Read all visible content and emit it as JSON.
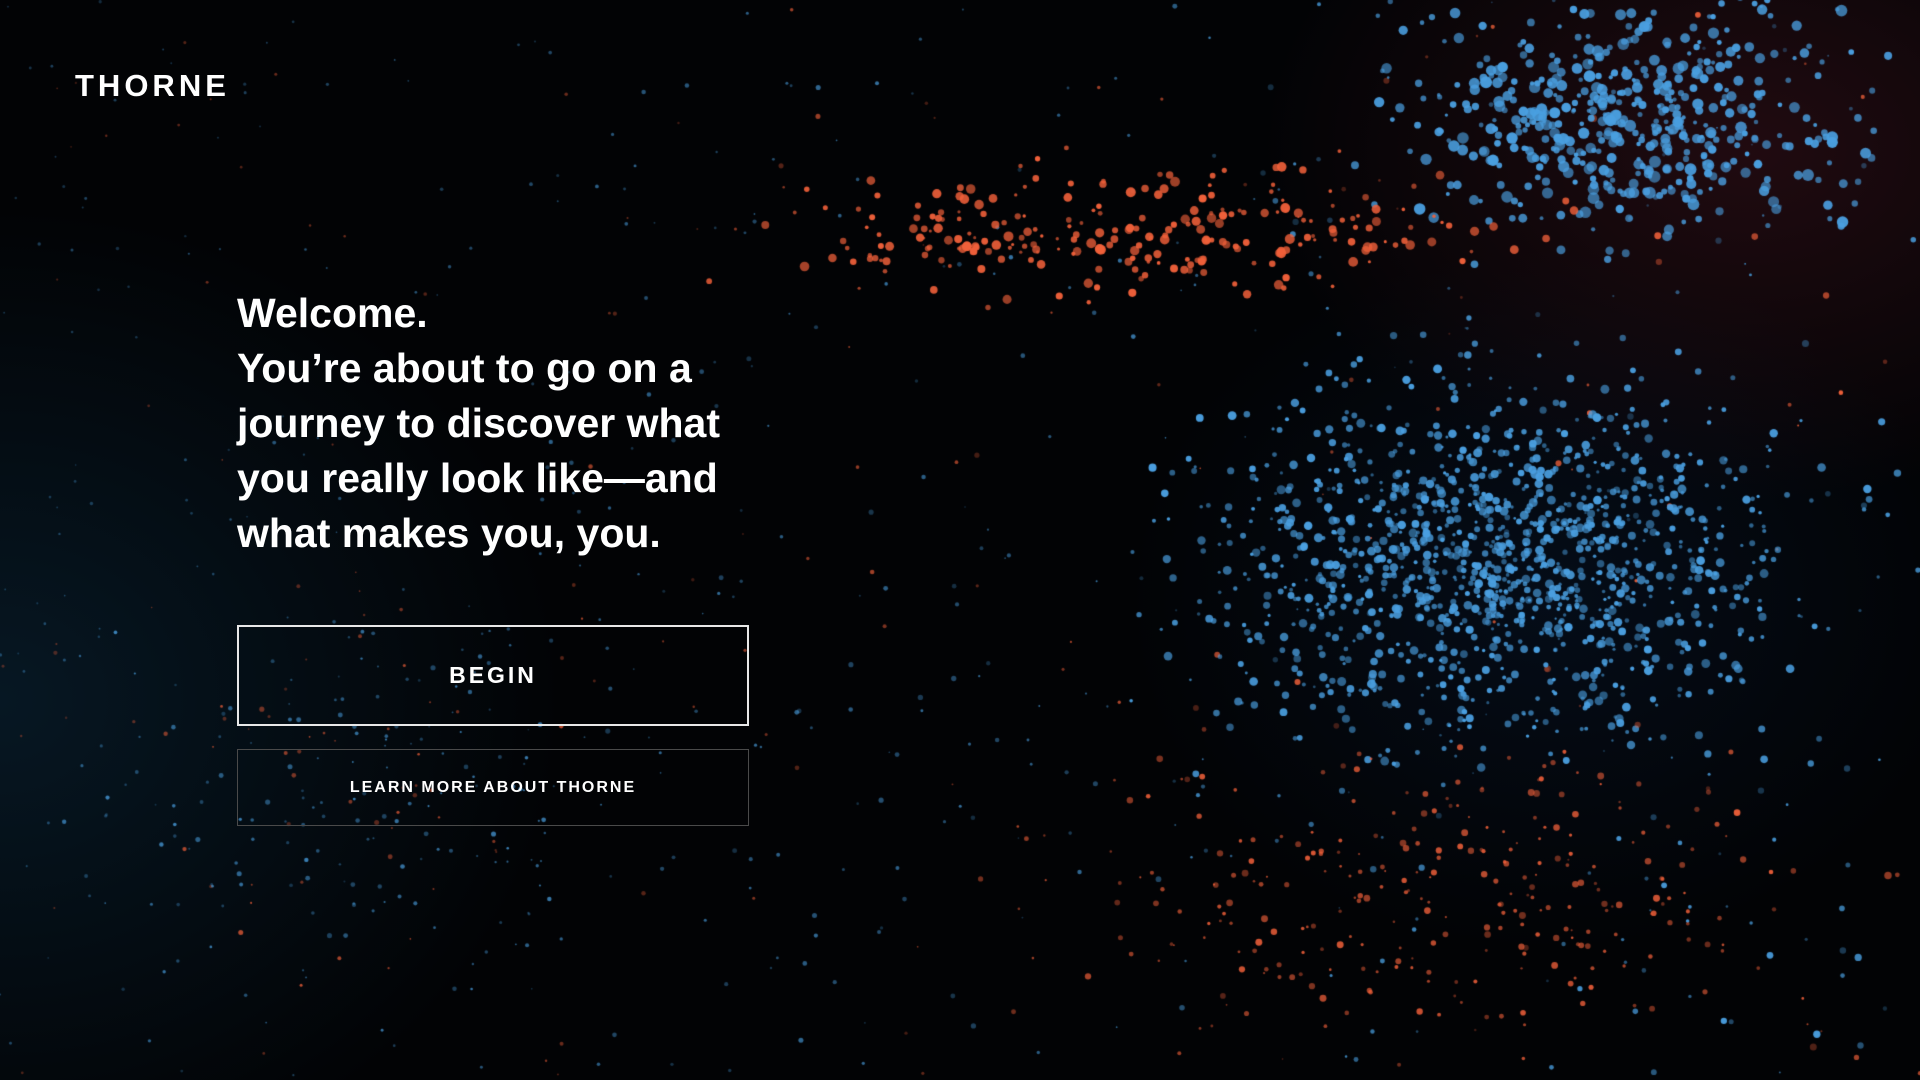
{
  "brand": {
    "logo_text": "THORNE"
  },
  "hero": {
    "headline": "Welcome.",
    "subhead": "You’re about to go on a journey to discover what you really look like—and what makes you, you."
  },
  "actions": {
    "begin_label": "BEGIN",
    "learn_more_label": "LEARN MORE ABOUT THORNE"
  },
  "colors": {
    "background": "#020305",
    "text": "#ffffff",
    "particle_blue": "#4a9fe0",
    "particle_orange": "#f0603a"
  }
}
